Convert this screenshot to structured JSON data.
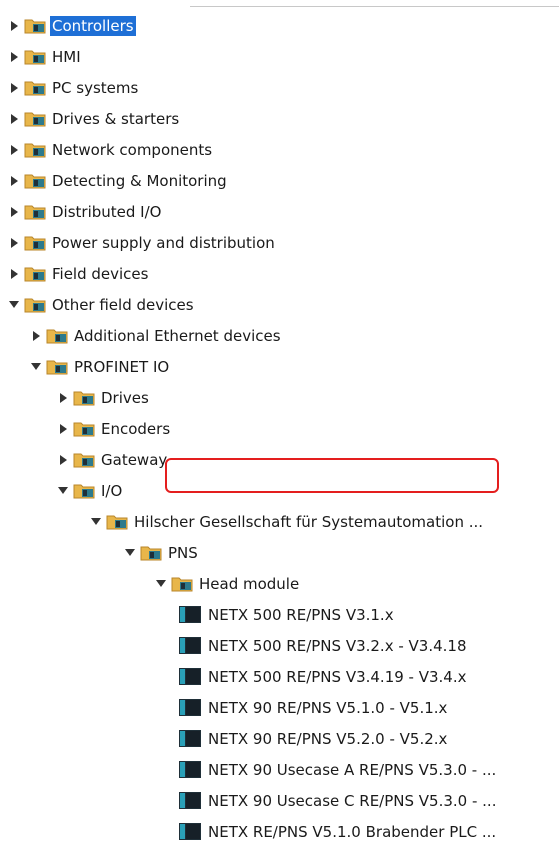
{
  "tree": {
    "items": [
      {
        "label": "Controllers",
        "depth": 0,
        "state": "collapsed",
        "icon": "folder-icon",
        "selected": true
      },
      {
        "label": "HMI",
        "depth": 0,
        "state": "collapsed",
        "icon": "folder-icon"
      },
      {
        "label": "PC systems",
        "depth": 0,
        "state": "collapsed",
        "icon": "folder-icon"
      },
      {
        "label": "Drives & starters",
        "depth": 0,
        "state": "collapsed",
        "icon": "folder-icon"
      },
      {
        "label": "Network components",
        "depth": 0,
        "state": "collapsed",
        "icon": "folder-icon"
      },
      {
        "label": "Detecting & Monitoring",
        "depth": 0,
        "state": "collapsed",
        "icon": "folder-icon"
      },
      {
        "label": "Distributed I/O",
        "depth": 0,
        "state": "collapsed",
        "icon": "folder-icon"
      },
      {
        "label": "Power supply and distribution",
        "depth": 0,
        "state": "collapsed",
        "icon": "folder-icon"
      },
      {
        "label": "Field devices",
        "depth": 0,
        "state": "collapsed",
        "icon": "folder-icon"
      },
      {
        "label": "Other field devices",
        "depth": 0,
        "state": "expanded",
        "icon": "folder-icon"
      },
      {
        "label": "Additional Ethernet devices",
        "depth": 1,
        "state": "collapsed",
        "icon": "folder-icon"
      },
      {
        "label": "PROFINET IO",
        "depth": 1,
        "state": "expanded",
        "icon": "folder-icon"
      },
      {
        "label": "Drives",
        "depth": 2,
        "state": "collapsed",
        "icon": "folder-icon"
      },
      {
        "label": "Encoders",
        "depth": 2,
        "state": "collapsed",
        "icon": "folder-icon"
      },
      {
        "label": "Gateway",
        "depth": 2,
        "state": "collapsed",
        "icon": "folder-icon"
      },
      {
        "label": "I/O",
        "depth": 2,
        "state": "expanded",
        "icon": "folder-icon"
      },
      {
        "label": "Hilscher Gesellschaft für Systemautomation ...",
        "depth": 3,
        "state": "expanded",
        "icon": "folder-icon"
      },
      {
        "label": "PNS",
        "depth": 4,
        "state": "expanded",
        "icon": "folder-icon"
      },
      {
        "label": "Head module",
        "depth": 5,
        "state": "expanded",
        "icon": "folder-icon"
      },
      {
        "label": "NETX 500 RE/PNS V3.1.x",
        "depth": 6,
        "state": "leaf",
        "icon": "device-module-icon"
      },
      {
        "label": "NETX 500 RE/PNS V3.2.x - V3.4.18",
        "depth": 6,
        "state": "leaf",
        "icon": "device-module-icon"
      },
      {
        "label": "NETX 500 RE/PNS V3.4.19 - V3.4.x",
        "depth": 6,
        "state": "leaf",
        "icon": "device-module-icon"
      },
      {
        "label": "NETX 90 RE/PNS V5.1.0 - V5.1.x",
        "depth": 6,
        "state": "leaf",
        "icon": "device-module-icon"
      },
      {
        "label": "NETX 90 RE/PNS V5.2.0 - V5.2.x",
        "depth": 6,
        "state": "leaf",
        "icon": "device-module-icon"
      },
      {
        "label": "NETX 90 Usecase A RE/PNS V5.3.0 - ...",
        "depth": 6,
        "state": "leaf",
        "icon": "device-module-icon"
      },
      {
        "label": "NETX 90 Usecase C RE/PNS V5.3.0 - ...",
        "depth": 6,
        "state": "leaf",
        "icon": "device-module-icon"
      },
      {
        "label": "NETX RE/PNS V5.1.0 Brabender PLC ...",
        "depth": 6,
        "state": "leaf",
        "icon": "device-module-icon"
      }
    ]
  },
  "colors": {
    "selection": "#1e6fd6",
    "highlight_box": "#e41e1e",
    "folder": "#e8b64a",
    "module": "#1a6e8c"
  }
}
